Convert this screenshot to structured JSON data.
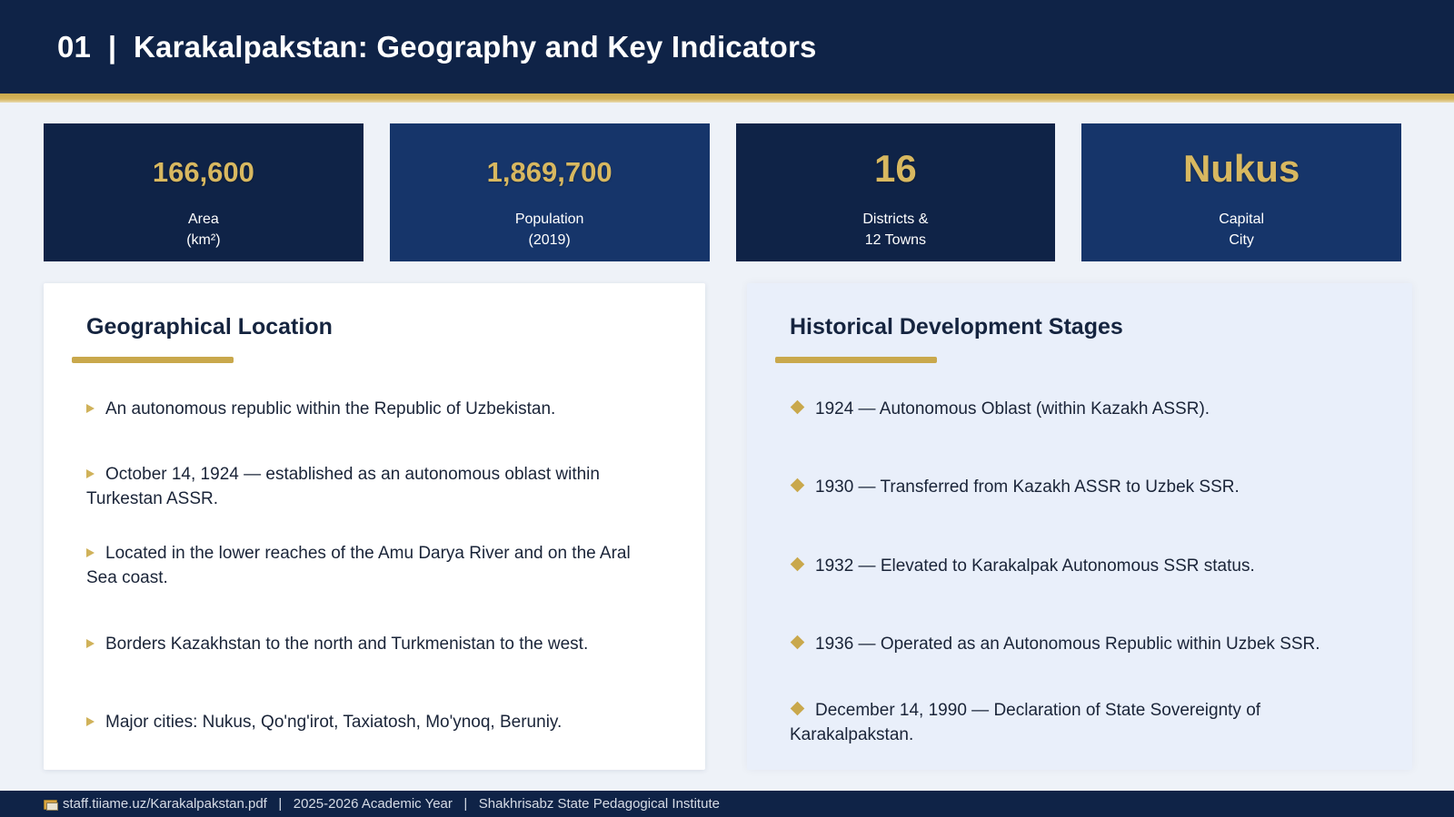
{
  "header": {
    "title": "01  |  Karakalpakstan: Geography and Key Indicators"
  },
  "stats": [
    {
      "value": "166,600",
      "label_line1": "Area",
      "label_line2": "(km²)"
    },
    {
      "value": "1,869,700",
      "label_line1": "Population",
      "label_line2": "(2019)"
    },
    {
      "value": "16",
      "label_line1": "Districts &",
      "label_line2": "12 Towns"
    },
    {
      "value": "Nukus",
      "label_line1": "Capital",
      "label_line2": "City"
    }
  ],
  "geography": {
    "title": "Geographical Location",
    "items": [
      "An autonomous republic within the Republic of Uzbekistan.",
      "October 14, 1924 — established as an autonomous oblast within Turkestan ASSR.",
      "Located in the lower reaches of the Amu Darya River and on the Aral Sea coast.",
      "Borders Kazakhstan to the north and Turkmenistan to the west.",
      "Major cities: Nukus, Qo'ng'irot, Taxiatosh, Mo'ynoq, Beruniy."
    ]
  },
  "history": {
    "title": "Historical Development Stages",
    "items": [
      "1924 — Autonomous Oblast (within Kazakh ASSR).",
      "1930 — Transferred from Kazakh ASSR to Uzbek SSR.",
      "1932 — Elevated to Karakalpak Autonomous SSR status.",
      "1936 — Operated as an Autonomous Republic within Uzbek SSR.",
      "December 14, 1990 — Declaration of State Sovereignty of Karakalpakstan."
    ]
  },
  "footer": {
    "icon": "book-icon",
    "text": "staff.tiiame.uz/Karakalpakstan.pdf   |   2025-2026 Academic Year   |   Shakhrisabz State Pedagogical Institute"
  },
  "colors": {
    "navy": "#0f2347",
    "navy_mid": "#16356a",
    "gold": "#c9a84c",
    "gold_text": "#d8b860"
  }
}
